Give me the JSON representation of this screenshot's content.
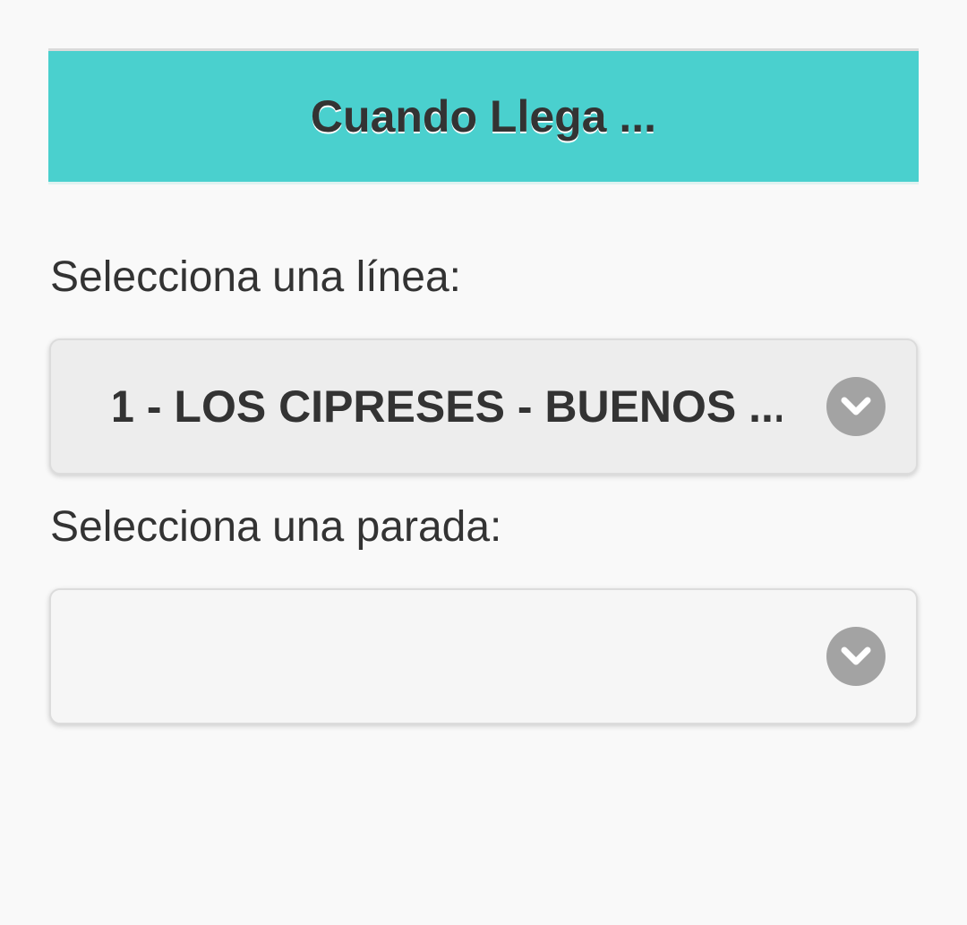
{
  "header": {
    "title": "Cuando Llega ..."
  },
  "line_selector": {
    "label": "Selecciona una línea:",
    "selected_value": "1 - LOS CIPRESES - BUENOS ...",
    "icon": "chevron-down-icon"
  },
  "stop_selector": {
    "label": "Selecciona una parada:",
    "selected_value": "",
    "icon": "chevron-down-icon"
  },
  "colors": {
    "header_background": "#4ad0ce",
    "page_background": "#f9f9f9",
    "text": "#333333",
    "chevron_circle": "#a3a3a3"
  }
}
